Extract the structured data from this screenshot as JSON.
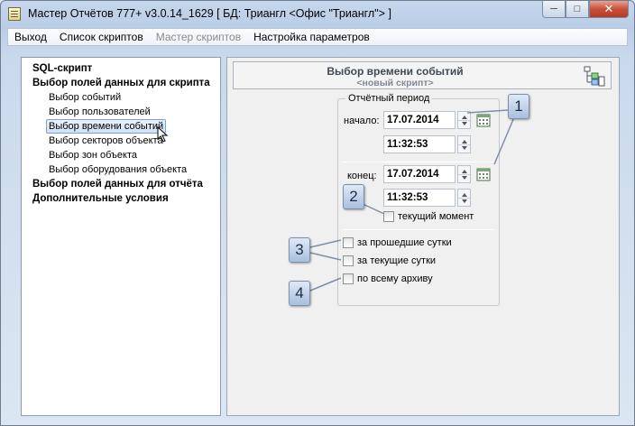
{
  "window": {
    "title": "Мастер Отчётов 777+ v3.0.14_1629 [ БД: Триангл <Офис \"Триангл\"> ]",
    "controls": {
      "minimize": "─",
      "maximize": "□",
      "close": "✕"
    }
  },
  "menu": {
    "items": [
      {
        "label": "Выход",
        "enabled": true
      },
      {
        "label": "Список скриптов",
        "enabled": true
      },
      {
        "label": "Мастер скриптов",
        "enabled": false
      },
      {
        "label": "Настройка параметров",
        "enabled": true
      }
    ]
  },
  "tree": {
    "items": [
      {
        "label": "SQL-скрипт",
        "level": 0,
        "bold": true
      },
      {
        "label": "Выбор полей данных для скрипта",
        "level": 0,
        "bold": true
      },
      {
        "label": "Выбор событий",
        "level": 1
      },
      {
        "label": "Выбор пользователей",
        "level": 1
      },
      {
        "label": "Выбор времени событий",
        "level": 1,
        "selected": true
      },
      {
        "label": "Выбор секторов объекта",
        "level": 1
      },
      {
        "label": "Выбор зон объекта",
        "level": 1
      },
      {
        "label": "Выбор оборудования объекта",
        "level": 1
      },
      {
        "label": "Выбор полей данных для отчёта",
        "level": 0,
        "bold": true
      },
      {
        "label": "Дополнительные условия",
        "level": 0,
        "bold": true
      }
    ]
  },
  "panel": {
    "title": "Выбор времени событий",
    "subtitle": "<новый скрипт>",
    "icon": "script-tree-icon"
  },
  "period": {
    "legend": "Отчётный период",
    "start_label": "начало:",
    "start_date": "17.07.2014",
    "start_time": "11:32:53",
    "end_label": "конец:",
    "end_date": "17.07.2014",
    "end_time": "11:32:53",
    "current_moment_label": "текущий момент",
    "current_moment_checked": false
  },
  "quick": {
    "past_day": "за прошедшие сутки",
    "current_day": "за текущие сутки",
    "whole_archive": "по всему архиву"
  },
  "callouts": [
    "1",
    "2",
    "3",
    "4"
  ],
  "colors": {
    "accent": "#3a6ea5",
    "selection": "#cfe0f5"
  }
}
